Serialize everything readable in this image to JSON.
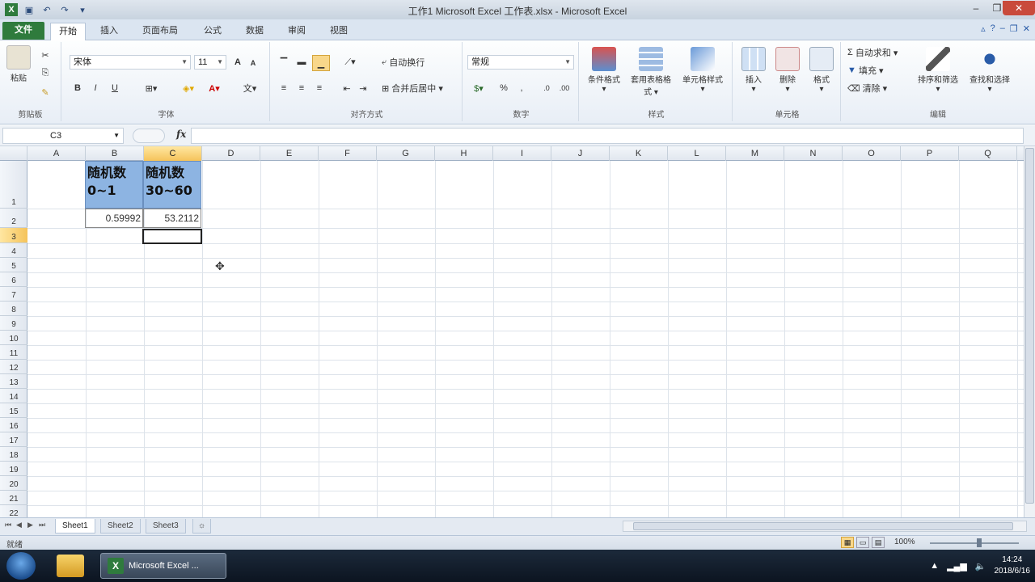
{
  "title": "工作1  Microsoft Excel 工作表.xlsx - Microsoft Excel",
  "ribbon_tabs": [
    "文件",
    "开始",
    "插入",
    "页面布局",
    "公式",
    "数据",
    "审阅",
    "视图"
  ],
  "ribbon": {
    "clipboard": {
      "paste_label": "粘贴",
      "group_label": "剪贴板"
    },
    "font": {
      "font_name": "宋体",
      "font_size": "11",
      "group_label": "字体"
    },
    "alignment": {
      "wrap_label": "自动换行",
      "merge_label": "合并后居中",
      "group_label": "对齐方式"
    },
    "number": {
      "format": "常规",
      "group_label": "数字"
    },
    "styles": {
      "cond_label": "条件格式",
      "table_label": "套用表格格式",
      "cellstyle_label": "单元格样式",
      "group_label": "样式"
    },
    "cells": {
      "insert_label": "插入",
      "delete_label": "删除",
      "format_label": "格式",
      "group_label": "单元格"
    },
    "editing": {
      "autosum_label": "自动求和",
      "fill_label": "填充",
      "clear_label": "清除",
      "sort_label": "排序和筛选",
      "find_label": "查找和选择",
      "group_label": "编辑"
    }
  },
  "formula_bar": {
    "name_box": "C3",
    "fx": "fx",
    "formula": ""
  },
  "columns": [
    "A",
    "B",
    "C",
    "D",
    "E",
    "F",
    "G",
    "H",
    "I",
    "J",
    "K",
    "L",
    "M",
    "N",
    "O",
    "P",
    "Q"
  ],
  "rows": [
    "1",
    "2",
    "3",
    "4",
    "5",
    "6",
    "7",
    "8",
    "9",
    "10",
    "11",
    "12",
    "13",
    "14",
    "15",
    "16",
    "17",
    "18",
    "19",
    "20",
    "21",
    "22"
  ],
  "cells": {
    "B1": "随机数\n0~1",
    "C1": "随机数\n30~60",
    "B2": "0.59992",
    "C2": "53.2112"
  },
  "sheets": [
    "Sheet1",
    "Sheet2",
    "Sheet3"
  ],
  "active_sheet": "Sheet1",
  "status": {
    "ready": "就绪",
    "zoom": "100%"
  },
  "taskbar": {
    "excel_label": "Microsoft Excel ...",
    "time": "14:24",
    "date": "2018/6/16"
  }
}
